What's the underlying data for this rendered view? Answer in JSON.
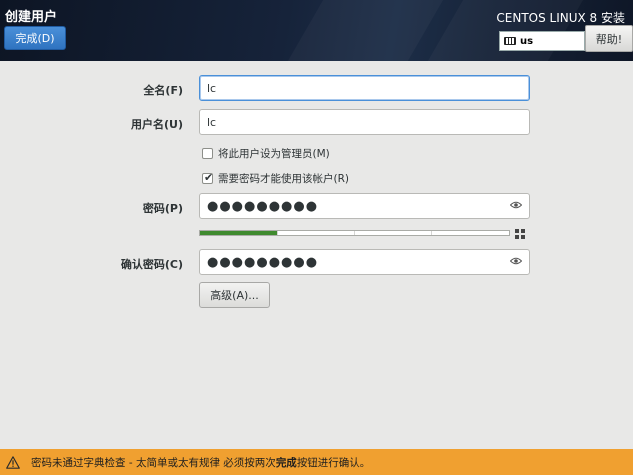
{
  "header": {
    "page_title": "创建用户",
    "done_label": "完成(D)",
    "product_title": "CENTOS LINUX 8 安装",
    "keyboard_layout": "us",
    "help_label": "帮助!"
  },
  "form": {
    "fullname_label": "全名(F)",
    "fullname_value": "lc",
    "username_label": "用户名(U)",
    "username_value": "lc",
    "admin_checkbox_label": "将此用户设为管理员(M)",
    "admin_checked": false,
    "require_password_label": "需要密码才能使用该帐户(R)",
    "require_password_checked": true,
    "password_label": "密码(P)",
    "password_value": "●●●●●●●●●",
    "password_strength": 0.25,
    "confirm_label": "确认密码(C)",
    "confirm_value": "●●●●●●●●●",
    "advanced_label": "高级(A)..."
  },
  "status": {
    "warning_prefix": "密码未通过字典检查 - 太简单或太有规律 必须按两次",
    "warning_bold": "完成",
    "warning_suffix": "按钮进行确认。"
  },
  "colors": {
    "accent": "#4a90d9",
    "warning_bar": "#f0a030",
    "strength_fill": "#3f8a2e"
  }
}
